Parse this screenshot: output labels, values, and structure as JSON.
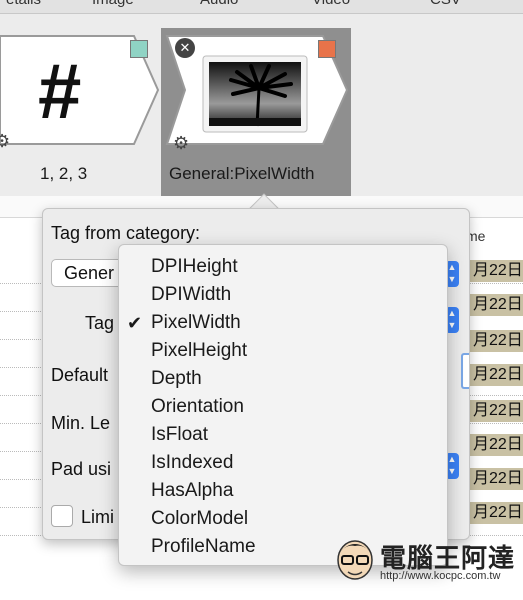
{
  "tabs": [
    "etails",
    "Image",
    "Audio",
    "Video",
    "CSV"
  ],
  "tokens": [
    {
      "caption": "1, 2, 3",
      "symbol": "#",
      "chip_color": "#8fd3c4"
    },
    {
      "caption": "General:PixelWidth",
      "chip_color": "#e8734a"
    }
  ],
  "background_table": {
    "header_fragment": "me",
    "date_fragment": "月22日"
  },
  "popover": {
    "tag_from_category_label": "Tag from category:",
    "category_value": "Gener",
    "tag_label": "Tag",
    "default_label": "Default",
    "min_length_label": "Min. Le",
    "pad_label": "Pad usi",
    "limit_label": "Limi"
  },
  "tag_menu": {
    "selected": "PixelWidth",
    "items": [
      "DPIHeight",
      "DPIWidth",
      "PixelWidth",
      "PixelHeight",
      "Depth",
      "Orientation",
      "IsFloat",
      "IsIndexed",
      "HasAlpha",
      "ColorModel",
      "ProfileName"
    ]
  },
  "watermark": {
    "title": "電腦王阿達",
    "url": "http://www.kocpc.com.tw"
  }
}
